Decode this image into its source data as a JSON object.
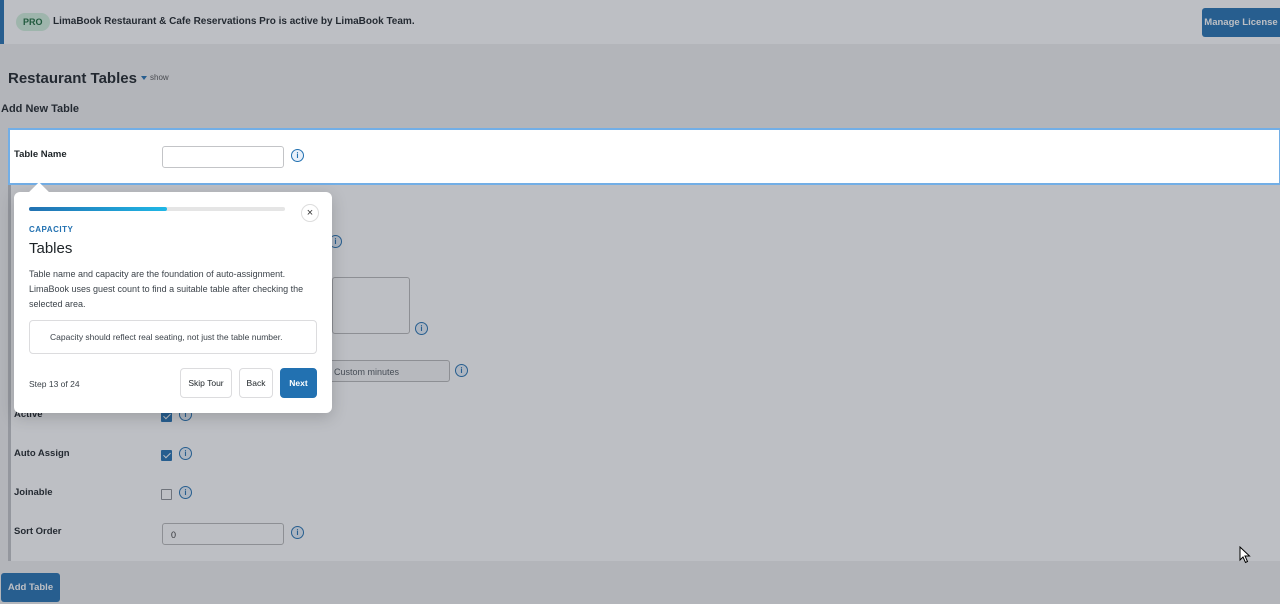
{
  "notice": {
    "badge": "PRO",
    "text": "LimaBook Restaurant & Cafe Reservations Pro is active by LimaBook Team.",
    "manage_label": "Manage License"
  },
  "page": {
    "title": "Restaurant Tables",
    "show_label": "show",
    "section_title": "Add New Table"
  },
  "form": {
    "table_name_label": "Table Name",
    "table_name_value": "",
    "active_label": "Active",
    "active_checked": true,
    "auto_assign_label": "Auto Assign",
    "auto_assign_checked": true,
    "joinable_label": "Joinable",
    "joinable_checked": false,
    "sort_order_label": "Sort Order",
    "sort_order_value": "0",
    "custom_minutes_placeholder": "Custom minutes",
    "add_table_label": "Add Table",
    "info_glyph": "i"
  },
  "tour": {
    "progress": 0.54,
    "kicker": "CAPACITY",
    "title": "Tables",
    "body": "Table name and capacity are the foundation of auto-assignment. LimaBook uses guest count to find a suitable table after checking the selected area.",
    "tip": "Capacity should reflect real seating, not just the table number.",
    "step": "Step 13 of 24",
    "skip_label": "Skip Tour",
    "back_label": "Back",
    "next_label": "Next",
    "close_glyph": "×"
  },
  "colors": {
    "accent": "#2271b1",
    "progress_end": "#1fb7e6"
  },
  "icons": [
    "caret-down-icon",
    "info-icon",
    "close-icon",
    "mouse-cursor-icon"
  ]
}
